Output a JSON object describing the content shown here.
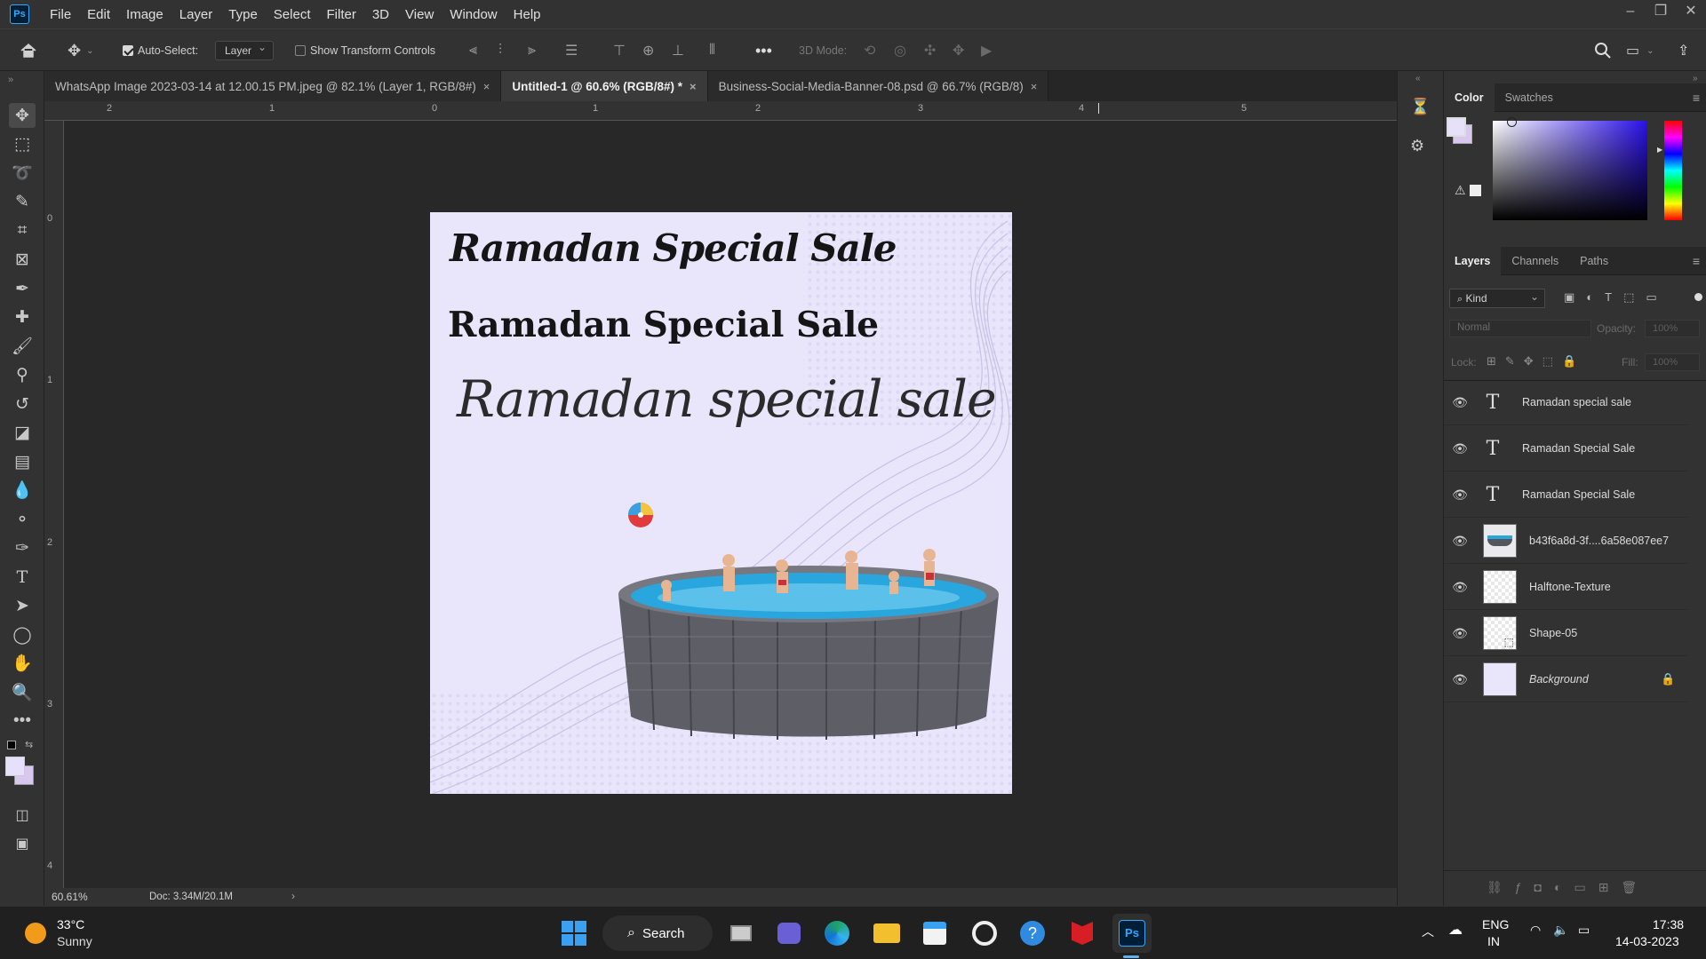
{
  "app": {
    "logo": "Ps"
  },
  "menu": [
    "File",
    "Edit",
    "Image",
    "Layer",
    "Type",
    "Select",
    "Filter",
    "3D",
    "View",
    "Window",
    "Help"
  ],
  "options": {
    "auto_select_label": "Auto-Select:",
    "auto_select_value": "Layer",
    "show_transform_label": "Show Transform Controls",
    "three_d_mode_label": "3D Mode:"
  },
  "tabs": [
    {
      "label": "WhatsApp Image 2023-03-14 at 12.00.15 PM.jpeg @ 82.1% (Layer 1, RGB/8#)",
      "close": "×"
    },
    {
      "label": "Untitled-1 @ 60.6% (RGB/8#) *",
      "close": "×"
    },
    {
      "label": "Business-Social-Media-Banner-08.psd @ 66.7% (RGB/8)",
      "close": "×"
    }
  ],
  "ruler_h": [
    "2",
    "1",
    "0",
    "1",
    "2",
    "3",
    "4",
    "5"
  ],
  "ruler_v": [
    "0",
    "1",
    "2",
    "3",
    "4"
  ],
  "canvas": {
    "text1": "Ramadan Special Sale",
    "text2": "Ramadan Special Sale",
    "text3": "Ramadan special sale"
  },
  "status": {
    "zoom": "60.61%",
    "doc": "Doc: 3.34M/20.1M",
    "arrow": "›"
  },
  "color_panel": {
    "tabs": [
      "Color",
      "Swatches"
    ]
  },
  "layers_panel": {
    "tabs": [
      "Layers",
      "Channels",
      "Paths"
    ],
    "filter_kind": "Kind",
    "blend_mode": "Normal",
    "opacity_label": "Opacity:",
    "opacity_value": "100%",
    "lock_label": "Lock:",
    "fill_label": "Fill:",
    "fill_value": "100%",
    "layers": [
      {
        "name": "Ramadan special sale",
        "type": "text"
      },
      {
        "name": "Ramadan Special Sale",
        "type": "text"
      },
      {
        "name": "Ramadan Special Sale",
        "type": "text"
      },
      {
        "name": "b43f6a8d-3f....6a58e087ee7",
        "type": "image"
      },
      {
        "name": "Halftone-Texture",
        "type": "image"
      },
      {
        "name": "Shape-05",
        "type": "shape"
      },
      {
        "name": "Background",
        "type": "background"
      }
    ]
  },
  "taskbar": {
    "weather_temp": "33°C",
    "weather_desc": "Sunny",
    "search_label": "Search",
    "lang": "ENG",
    "region": "IN",
    "time": "17:38",
    "date": "14-03-2023"
  },
  "colors": {
    "accent": "#31a8ff",
    "canvas_bg": "#e9e5fb",
    "foreground_swatch": "#e6e0fb",
    "background_swatch": "#d8c8f0"
  }
}
